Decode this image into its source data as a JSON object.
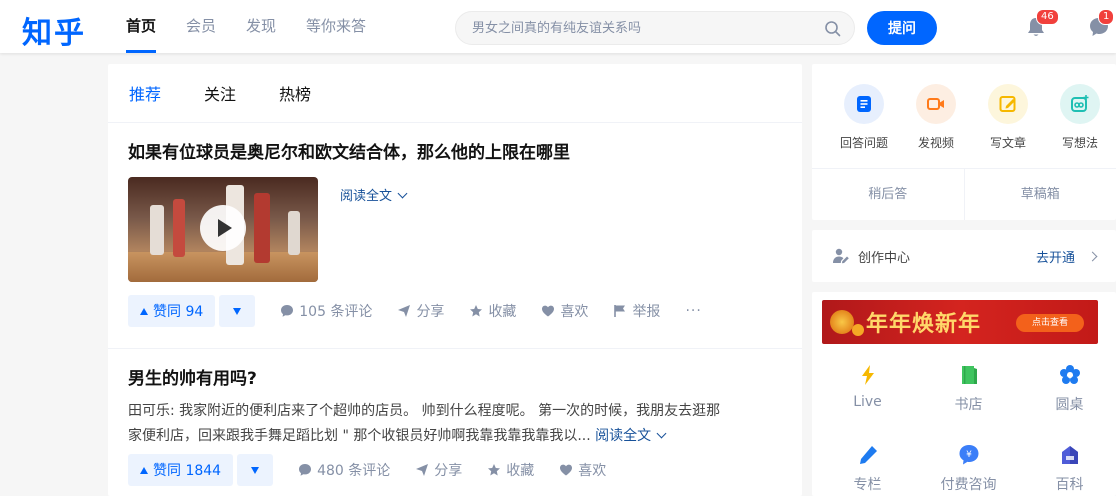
{
  "header": {
    "logo": "知乎",
    "nav": [
      {
        "label": "首页",
        "active": true
      },
      {
        "label": "会员",
        "active": false
      },
      {
        "label": "发现",
        "active": false
      },
      {
        "label": "等你来答",
        "active": false
      }
    ],
    "search_placeholder": "男女之间真的有纯友谊关系吗",
    "ask_label": "提问",
    "notification_count": "46",
    "message_count": "1"
  },
  "feed": {
    "tabs": [
      {
        "label": "推荐",
        "active": true
      },
      {
        "label": "关注",
        "active": false
      },
      {
        "label": "热榜",
        "active": false
      }
    ],
    "items": [
      {
        "title": "如果有位球员是奥尼尔和欧文结合体，那么他的上限在哪里",
        "read_more": "阅读全文",
        "vote_label": "赞同 94",
        "comments": "105 条评论",
        "share": "分享",
        "collect": "收藏",
        "like": "喜欢",
        "report": "举报",
        "more": "···"
      },
      {
        "title": "男生的帅有用吗?",
        "author": "田可乐:",
        "excerpt_line1": "我家附近的便利店来了个超帅的店员。 帅到什么程度呢。 第一次的时候，我朋友去逛那",
        "excerpt_line2": "家便利店，回来跟我手舞足蹈比划 \" 那个收银员好帅啊我靠我靠我靠我以...",
        "read_more": "阅读全文",
        "vote_label": "赞同 1844",
        "comments": "480 条评论",
        "share": "分享",
        "collect": "收藏",
        "like": "喜欢"
      }
    ]
  },
  "sidebar": {
    "creator_actions": [
      {
        "label": "回答问题",
        "icon": "answer-icon",
        "color": "#0066ff",
        "bg": "#e7effd"
      },
      {
        "label": "发视频",
        "icon": "video-icon",
        "color": "#ff7a1a",
        "bg": "#fdeee2"
      },
      {
        "label": "写文章",
        "icon": "write-icon",
        "color": "#f6b800",
        "bg": "#fdf6dc"
      },
      {
        "label": "写想法",
        "icon": "idea-icon",
        "color": "#1fbfb3",
        "bg": "#dff5f3"
      }
    ],
    "later_answer": "稍后答",
    "drafts": "草稿箱",
    "creator_center": "创作中心",
    "go_open": "去开通",
    "banner_title": "年年焕新年",
    "banner_button": "点击查看",
    "apps": [
      {
        "label": "Live",
        "icon": "live-icon",
        "color": "#f6b800"
      },
      {
        "label": "书店",
        "icon": "bookstore-icon",
        "color": "#3fc45f"
      },
      {
        "label": "圆桌",
        "icon": "roundtable-icon",
        "color": "#1e7bf0"
      },
      {
        "label": "专栏",
        "icon": "column-icon",
        "color": "#1e7bf0"
      },
      {
        "label": "付费咨询",
        "icon": "consult-icon",
        "color": "#3b7ef8"
      },
      {
        "label": "百科",
        "icon": "encyclopedia-icon",
        "color": "#4f5cd8"
      }
    ]
  }
}
